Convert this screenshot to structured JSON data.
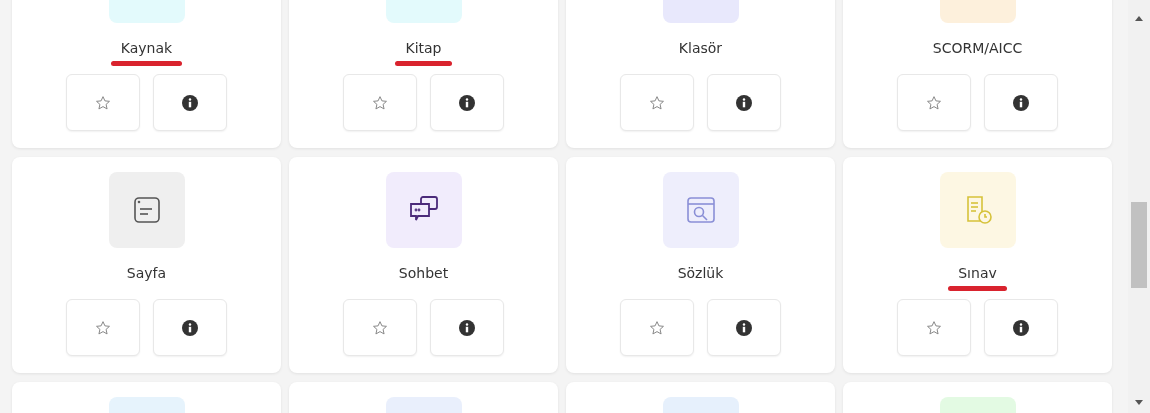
{
  "rows": [
    {
      "cards": [
        {
          "label": "Kaynak",
          "color": "#e3fafc",
          "highlighted": true
        },
        {
          "label": "Kitap",
          "color": "#e3fafc",
          "highlighted": true
        },
        {
          "label": "Klasör",
          "color": "#e8e8fc",
          "highlighted": false
        },
        {
          "label": "SCORM/AICC",
          "color": "#fdf0dc",
          "highlighted": false
        }
      ]
    },
    {
      "cards": [
        {
          "label": "Sayfa",
          "color": "#efefef",
          "kind": "page",
          "highlighted": false
        },
        {
          "label": "Sohbet",
          "color": "#f1ecfc",
          "kind": "chat",
          "highlighted": false
        },
        {
          "label": "Sözlük",
          "color": "#eeeefc",
          "kind": "window",
          "highlighted": false
        },
        {
          "label": "Sınav",
          "color": "#fdf7e3",
          "kind": "exam",
          "highlighted": true
        }
      ]
    },
    {
      "cards": [
        {
          "color": "#e6f3fc"
        },
        {
          "color": "#e9effc"
        },
        {
          "color": "#e6f0fc"
        },
        {
          "color": "#e3fae3"
        }
      ]
    }
  ]
}
